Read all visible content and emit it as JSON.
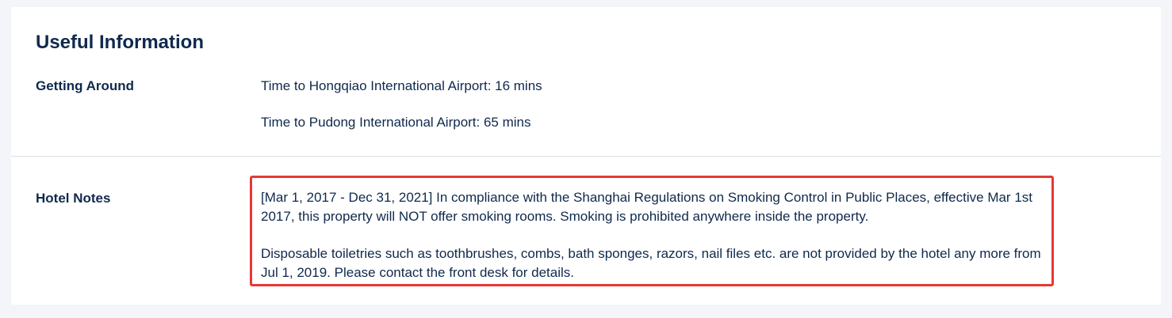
{
  "section": {
    "title": "Useful Information"
  },
  "getting_around": {
    "label": "Getting Around",
    "items": [
      "Time to Hongqiao International Airport: 16 mins",
      "Time to Pudong International Airport: 65 mins"
    ]
  },
  "hotel_notes": {
    "label": "Hotel Notes",
    "notes": [
      "[Mar 1, 2017 - Dec 31, 2021] In compliance with the Shanghai Regulations on Smoking Control in Public Places, effective Mar 1st 2017, this property will NOT offer smoking rooms. Smoking is prohibited anywhere inside the property.",
      "Disposable toiletries such as toothbrushes, combs, bath sponges, razors, nail files etc. are not provided by the hotel any more from Jul 1, 2019. Please contact the front desk for details."
    ]
  },
  "colors": {
    "text": "#0f294d",
    "page_background": "#f4f5f9",
    "card_background": "#ffffff",
    "highlight_border": "#e53935",
    "divider": "#dadfe6"
  }
}
